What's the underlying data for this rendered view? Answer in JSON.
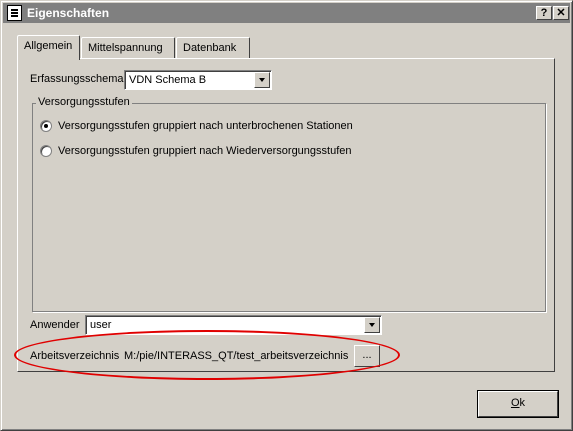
{
  "window": {
    "title": "Eigenschaften"
  },
  "titlebar": {
    "help_label": "?",
    "close_label": "✕"
  },
  "tabs": [
    {
      "label": "Allgemein",
      "active": true
    },
    {
      "label": "Mittelspannung",
      "active": false
    },
    {
      "label": "Datenbank",
      "active": false
    }
  ],
  "erfassung": {
    "label": "Erfassungsschema",
    "value": "VDN Schema B"
  },
  "versorgung": {
    "group_label": "Versorgungsstufen",
    "options": [
      {
        "label": "Versorgungsstufen gruppiert nach unterbrochenen Stationen",
        "checked": true
      },
      {
        "label": "Versorgungsstufen gruppiert nach Wiederversorgungsstufen",
        "checked": false
      }
    ]
  },
  "anwender": {
    "label": "Anwender",
    "value": "user"
  },
  "arbeitsverzeichnis": {
    "label": "Arbeitsverzeichnis",
    "value": "M:/pie/INTERASS_QT/test_arbeitsverzeichnis",
    "browse_label": "..."
  },
  "ok_button": {
    "label": "Ok",
    "hotkey": "O",
    "rest": "k"
  },
  "colors": {
    "titlebar": "#808080",
    "face": "#d4d0c8",
    "highlight_ellipse": "#e00000"
  }
}
